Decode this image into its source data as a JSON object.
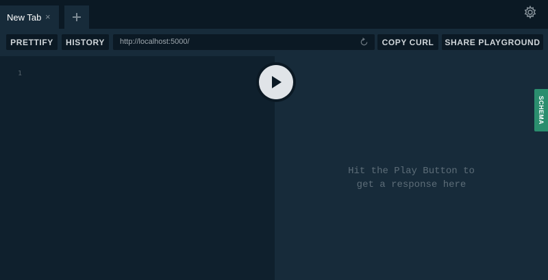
{
  "tabs": {
    "items": [
      {
        "title": "New Tab",
        "close_glyph": "×"
      }
    ],
    "add_icon": "plus-icon",
    "settings_icon": "gear-icon"
  },
  "toolbar": {
    "prettify_label": "PRETTIFY",
    "history_label": "HISTORY",
    "url_value": "http://localhost:5000/",
    "reload_icon": "reload-icon",
    "copy_curl_label": "COPY CURL",
    "share_label": "SHARE PLAYGROUND"
  },
  "editor": {
    "line_numbers": [
      "1"
    ]
  },
  "play_icon": "play-icon",
  "result": {
    "placeholder_line1": "Hit the Play Button to",
    "placeholder_line2": "get a response here"
  },
  "schema_tab": {
    "label": "SCHEMA"
  },
  "colors": {
    "background": "#0f202d",
    "panel": "#172b3a",
    "dark": "#0b1924",
    "schema_accent": "#2b8e6e"
  }
}
